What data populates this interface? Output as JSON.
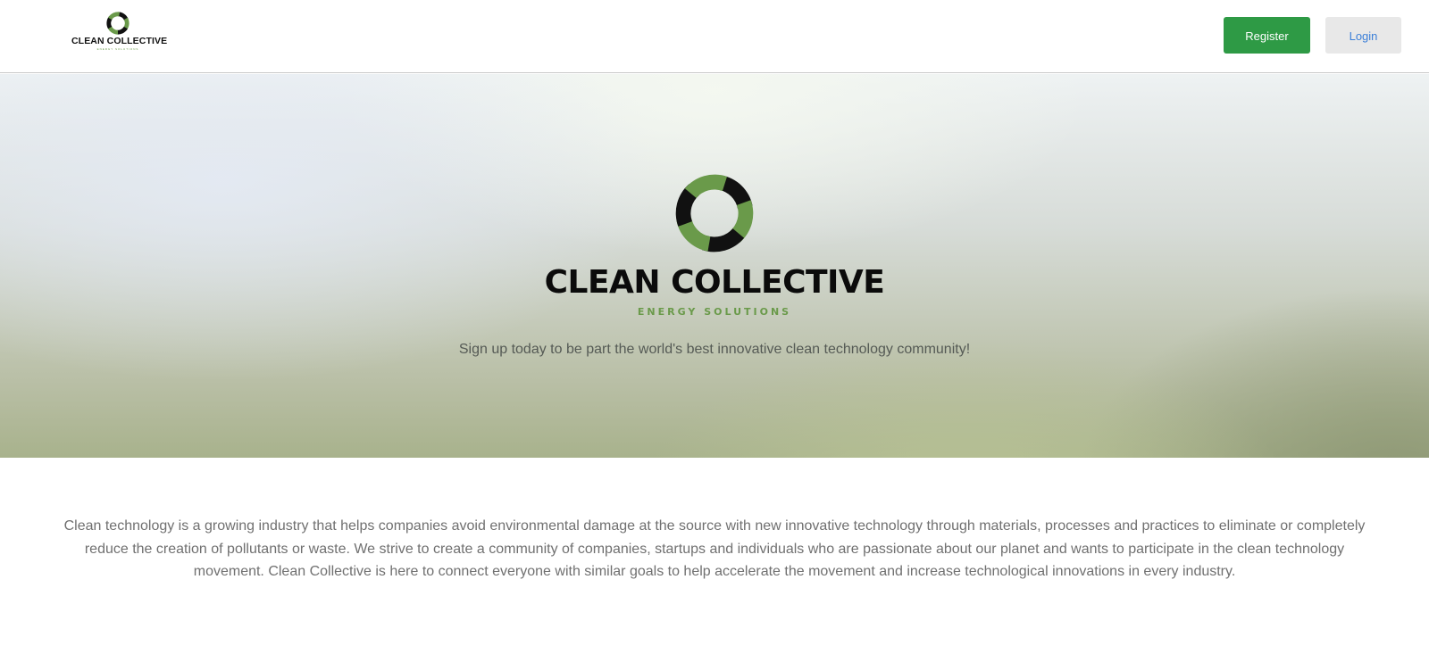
{
  "header": {
    "brand_name": "CLEAN COLLECTIVE",
    "brand_tagline": "ENERGY SOLUTIONS",
    "register_label": "Register",
    "login_label": "Login"
  },
  "hero": {
    "logo_title": "CLEAN COLLECTIVE",
    "logo_tagline": "ENERGY SOLUTIONS",
    "subtitle": "Sign up today to be part the world's best innovative clean technology community!"
  },
  "about": {
    "text": "Clean technology is a growing industry that helps companies avoid environmental damage at the source with new innovative technology through materials, processes and practices to eliminate or completely reduce the creation of pollutants or waste. We strive to create a community of companies, startups and individuals who are passionate about our planet and wants to participate in the clean technology movement. Clean Collective is here to connect everyone with similar goals to help accelerate the movement and increase technological innovations in every industry."
  },
  "colors": {
    "brand_green": "#2e9a45",
    "logo_green": "#6a9a4a",
    "login_text": "#3b7fd8"
  }
}
